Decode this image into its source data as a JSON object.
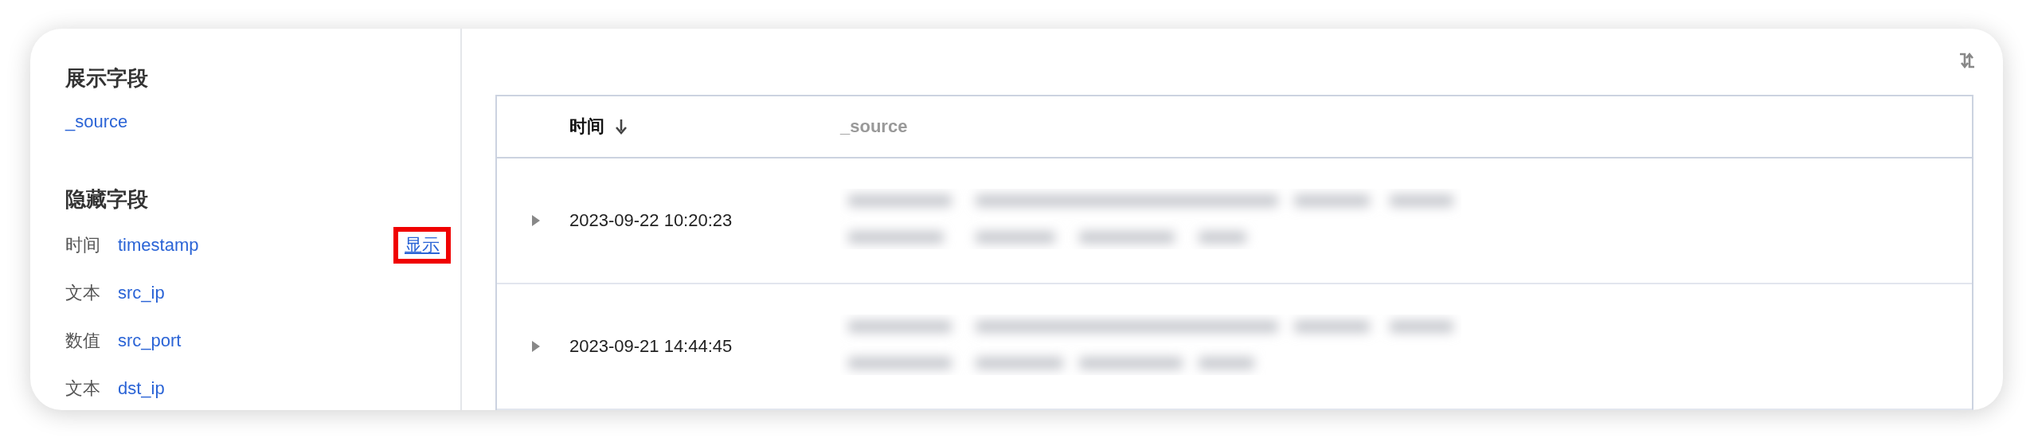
{
  "visible_fields": {
    "title": "展示字段",
    "items": [
      {
        "name": "_source"
      }
    ]
  },
  "hidden_fields": {
    "title": "隐藏字段",
    "items": [
      {
        "type": "时间",
        "name": "timestamp",
        "action": "显示",
        "highlighted": true
      },
      {
        "type": "文本",
        "name": "src_ip"
      },
      {
        "type": "数值",
        "name": "src_port"
      },
      {
        "type": "文本",
        "name": "dst_ip"
      }
    ]
  },
  "table": {
    "columns": [
      {
        "label": "时间",
        "sort_descending": true
      },
      {
        "label": "_source"
      }
    ],
    "rows": [
      {
        "expanded": false,
        "time": "2023-09-22 10:20:23"
      },
      {
        "expanded": false,
        "time": "2023-09-21 14:44:45"
      }
    ]
  }
}
